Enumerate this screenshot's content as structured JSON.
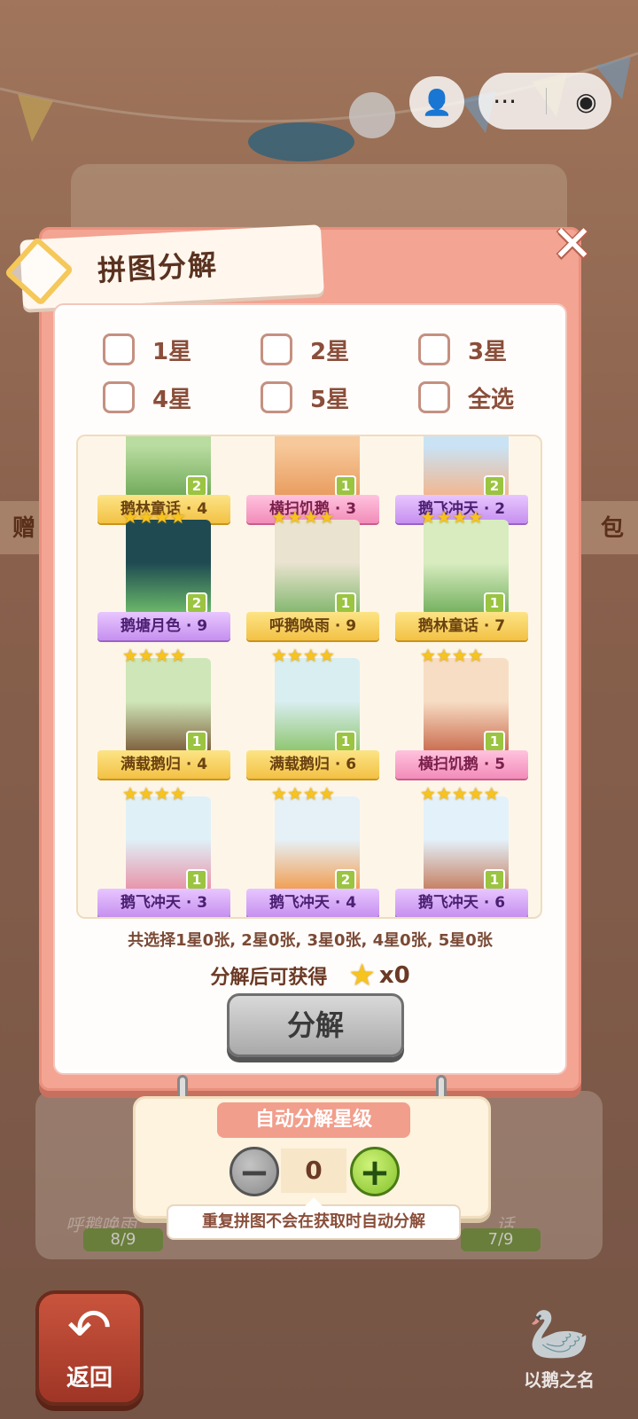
{
  "title": "拼图分解",
  "filters": [
    {
      "label": "1星"
    },
    {
      "label": "2星"
    },
    {
      "label": "3星"
    },
    {
      "label": "4星"
    },
    {
      "label": "5星"
    },
    {
      "label": "全选"
    }
  ],
  "pieces": [
    {
      "name": "鹅林童话 · 4",
      "count": "2",
      "stars": 0,
      "ribbon": "gold",
      "scene": "green"
    },
    {
      "name": "横扫饥鹅 · 3",
      "count": "1",
      "stars": 0,
      "ribbon": "pink",
      "scene": "orange"
    },
    {
      "name": "鹅飞冲天 · 2",
      "count": "2",
      "stars": 0,
      "ribbon": "purple",
      "scene": "sky"
    },
    {
      "name": "鹅塘月色 · 9",
      "count": "2",
      "stars": 4,
      "ribbon": "purple",
      "scene": "night"
    },
    {
      "name": "呼鹅唤雨 · 9",
      "count": "1",
      "stars": 4,
      "ribbon": "gold",
      "scene": "garden"
    },
    {
      "name": "鹅林童话 · 7",
      "count": "1",
      "stars": 4,
      "ribbon": "gold",
      "scene": "pond"
    },
    {
      "name": "满载鹅归 · 4",
      "count": "1",
      "stars": 4,
      "ribbon": "gold",
      "scene": "forest"
    },
    {
      "name": "满载鹅归 · 6",
      "count": "1",
      "stars": 4,
      "ribbon": "gold",
      "scene": "meadow"
    },
    {
      "name": "横扫饥鹅 · 5",
      "count": "1",
      "stars": 4,
      "ribbon": "pink",
      "scene": "shop"
    },
    {
      "name": "鹅飞冲天 · 3",
      "count": "1",
      "stars": 4,
      "ribbon": "purple",
      "scene": "balloon1"
    },
    {
      "name": "鹅飞冲天 · 4",
      "count": "2",
      "stars": 4,
      "ribbon": "purple",
      "scene": "balloon2"
    },
    {
      "name": "鹅飞冲天 · 6",
      "count": "1",
      "stars": 5,
      "ribbon": "purple",
      "scene": "flowers"
    }
  ],
  "summary": "共选择1星0张, 2星0张, 3星0张, 4星0张, 5星0张",
  "reward_label": "分解后可获得",
  "reward_count": "x0",
  "decompose_label": "分解",
  "auto": {
    "header": "自动分解星级",
    "value": "0",
    "minus": "−",
    "plus": "+",
    "tip": "重复拼图不会在获取时自动分解"
  },
  "background": {
    "left_tag": "赠",
    "right_tag": "包",
    "card_left_name": "呼鹅唤雨",
    "card_right_name": "话",
    "progress_left": "8/9",
    "progress_right": "7/9",
    "back_label": "返回",
    "brand": "以鹅之名"
  },
  "colors": {
    "modal": "#f3a493",
    "star": "#f6c31f",
    "badge": "#9bc441",
    "plus": "#84c22b"
  }
}
